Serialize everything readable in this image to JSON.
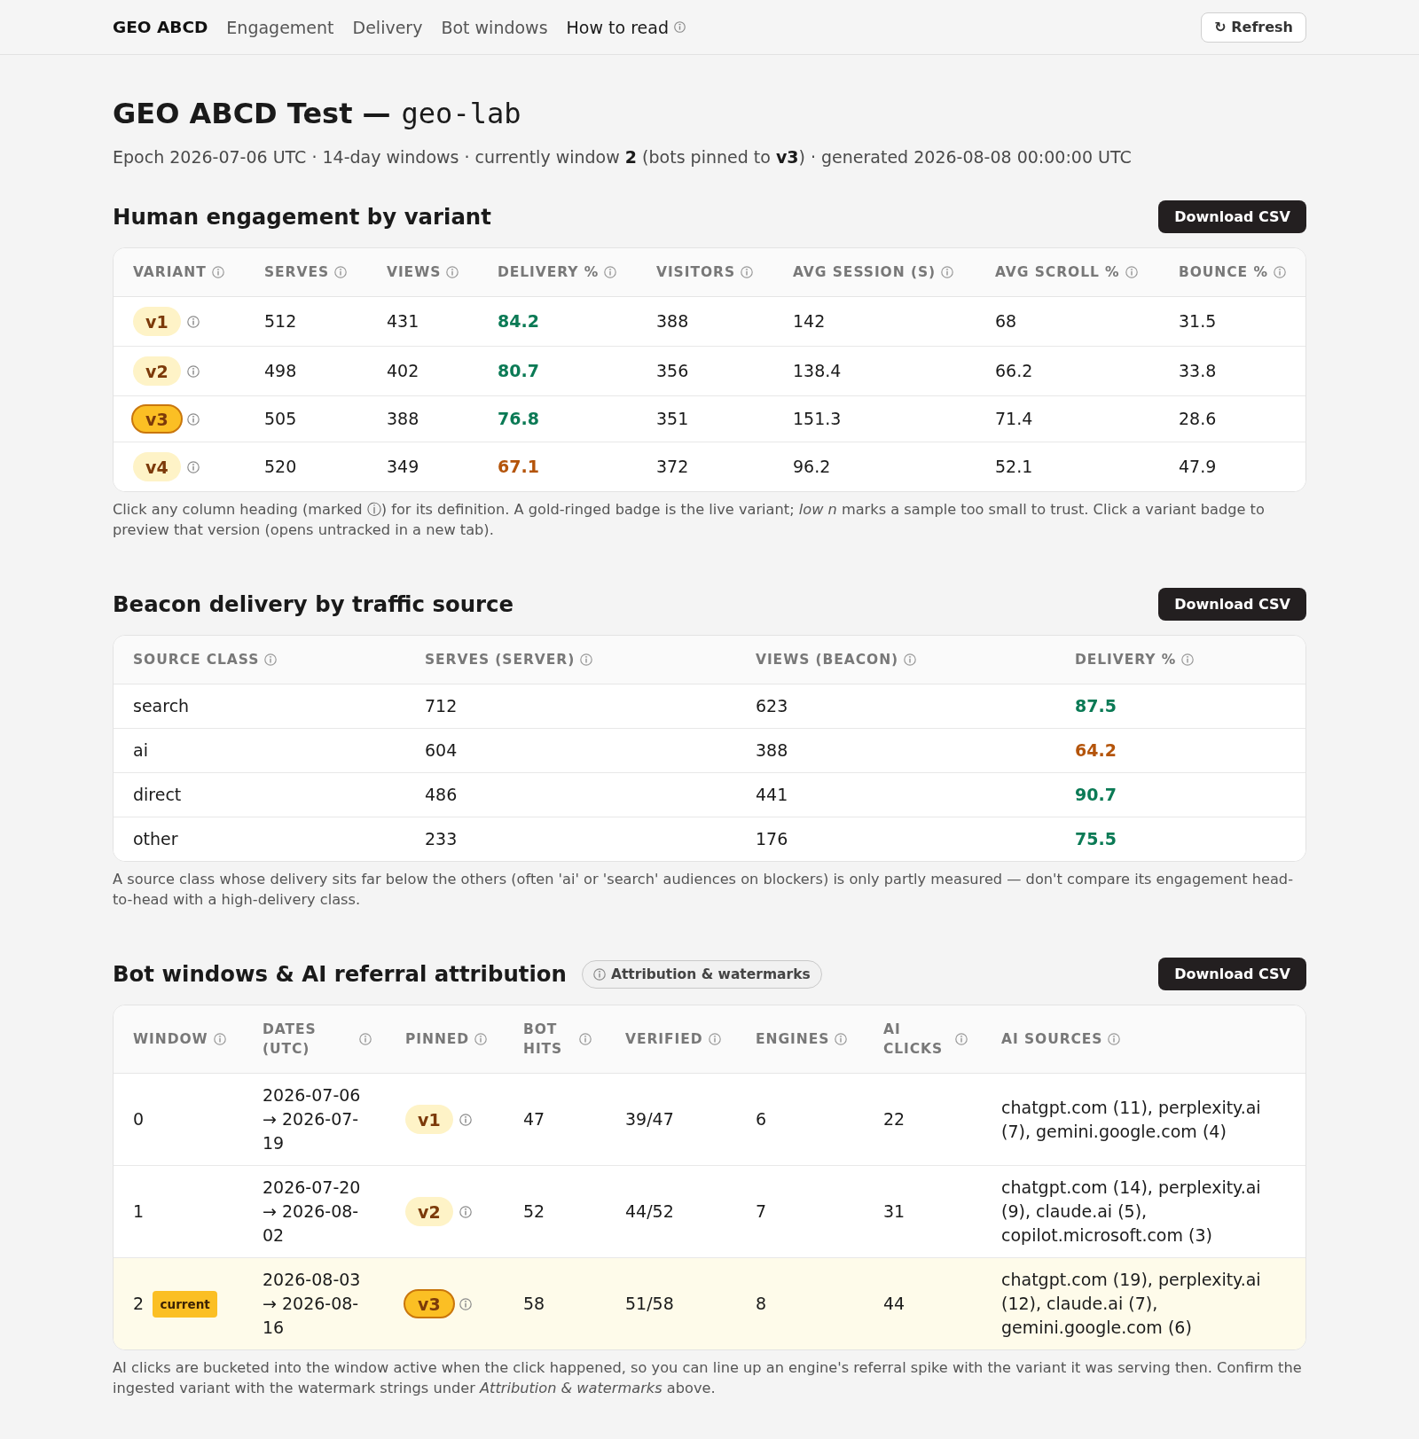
{
  "nav": {
    "brand": "GEO ABCD",
    "links": [
      {
        "label": "Engagement",
        "kind": "link"
      },
      {
        "label": "Delivery",
        "kind": "link"
      },
      {
        "label": "Bot windows",
        "kind": "link"
      },
      {
        "label": "How to read",
        "kind": "help"
      }
    ],
    "refresh": "↻ Refresh"
  },
  "header": {
    "title": "GEO ABCD Test —",
    "slug": "geo-lab",
    "subtitle": "Epoch 2026-07-06 UTC · 14-day windows · currently window **2** (bots pinned to **v3**) · generated 2026-08-08 00:00:00 UTC"
  },
  "sections": [
    {
      "title": "Human engagement by variant",
      "download": "Download CSV",
      "columns": [
        "VARIANT",
        "SERVES",
        "VIEWS",
        "DELIVERY %",
        "VISITORS",
        "AVG SESSION (S)",
        "AVG SCROLL %",
        "BOUNCE %"
      ],
      "rows": [
        {
          "cells": [
            {
              "kind": "variant",
              "text": "v1",
              "live": false
            },
            {
              "kind": "text",
              "text": "512"
            },
            {
              "kind": "text",
              "text": "431"
            },
            {
              "kind": "delivery",
              "text": "84.2",
              "low": false
            },
            {
              "kind": "text",
              "text": "388"
            },
            {
              "kind": "text",
              "text": "142"
            },
            {
              "kind": "text",
              "text": "68"
            },
            {
              "kind": "text",
              "text": "31.5"
            }
          ]
        },
        {
          "cells": [
            {
              "kind": "variant",
              "text": "v2",
              "live": false
            },
            {
              "kind": "text",
              "text": "498"
            },
            {
              "kind": "text",
              "text": "402"
            },
            {
              "kind": "delivery",
              "text": "80.7",
              "low": false
            },
            {
              "kind": "text",
              "text": "356"
            },
            {
              "kind": "text",
              "text": "138.4"
            },
            {
              "kind": "text",
              "text": "66.2"
            },
            {
              "kind": "text",
              "text": "33.8"
            }
          ]
        },
        {
          "cells": [
            {
              "kind": "variant",
              "text": "v3",
              "live": true
            },
            {
              "kind": "text",
              "text": "505"
            },
            {
              "kind": "text",
              "text": "388"
            },
            {
              "kind": "delivery",
              "text": "76.8",
              "low": false
            },
            {
              "kind": "text",
              "text": "351"
            },
            {
              "kind": "text",
              "text": "151.3"
            },
            {
              "kind": "text",
              "text": "71.4"
            },
            {
              "kind": "text",
              "text": "28.6"
            }
          ]
        },
        {
          "cells": [
            {
              "kind": "variant",
              "text": "v4",
              "live": false
            },
            {
              "kind": "text",
              "text": "520"
            },
            {
              "kind": "text",
              "text": "349"
            },
            {
              "kind": "delivery",
              "text": "67.1",
              "low": true
            },
            {
              "kind": "text",
              "text": "372"
            },
            {
              "kind": "text",
              "text": "96.2"
            },
            {
              "kind": "text",
              "text": "52.1"
            },
            {
              "kind": "text",
              "text": "47.9"
            }
          ]
        }
      ],
      "note": "Click any column heading (marked ⓘ) for its definition. A gold-ringed badge is the live variant; *low n* marks a sample too small to trust. Click a variant badge to preview that version (opens untracked in a new tab)."
    },
    {
      "title": "Beacon delivery by traffic source",
      "download": "Download CSV",
      "columns": [
        "SOURCE CLASS",
        "SERVES (SERVER)",
        "VIEWS (BEACON)",
        "DELIVERY %"
      ],
      "rows": [
        {
          "cells": [
            {
              "kind": "text",
              "text": "search"
            },
            {
              "kind": "text",
              "text": "712"
            },
            {
              "kind": "text",
              "text": "623"
            },
            {
              "kind": "delivery",
              "text": "87.5",
              "low": false
            }
          ]
        },
        {
          "cells": [
            {
              "kind": "text",
              "text": "ai"
            },
            {
              "kind": "text",
              "text": "604"
            },
            {
              "kind": "text",
              "text": "388"
            },
            {
              "kind": "delivery",
              "text": "64.2",
              "low": true
            }
          ]
        },
        {
          "cells": [
            {
              "kind": "text",
              "text": "direct"
            },
            {
              "kind": "text",
              "text": "486"
            },
            {
              "kind": "text",
              "text": "441"
            },
            {
              "kind": "delivery",
              "text": "90.7",
              "low": false
            }
          ]
        },
        {
          "cells": [
            {
              "kind": "text",
              "text": "other"
            },
            {
              "kind": "text",
              "text": "233"
            },
            {
              "kind": "text",
              "text": "176"
            },
            {
              "kind": "delivery",
              "text": "75.5",
              "low": false
            }
          ]
        }
      ],
      "note": "A source class whose delivery sits far below the others (often 'ai' or 'search' audiences on blockers) is only partly measured — don't compare its engagement head-to-head with a high-delivery class."
    },
    {
      "title": "Bot windows & AI referral attribution",
      "help": "Attribution & watermarks",
      "download": "Download CSV",
      "columns": [
        "WINDOW",
        "DATES (UTC)",
        "PINNED",
        "BOT HITS",
        "VERIFIED",
        "ENGINES",
        "AI CLICKS",
        "AI SOURCES"
      ],
      "rows": [
        {
          "current": false,
          "cells": [
            {
              "kind": "text",
              "text": "0"
            },
            {
              "kind": "text",
              "text": "2026-07-06 → 2026-07-19"
            },
            {
              "kind": "variant",
              "text": "v1",
              "live": false
            },
            {
              "kind": "text",
              "text": "47"
            },
            {
              "kind": "text",
              "text": "39/47"
            },
            {
              "kind": "text",
              "text": "6"
            },
            {
              "kind": "text",
              "text": "22"
            },
            {
              "kind": "text",
              "text": "chatgpt.com (11), perplexity.ai (7), gemini.google.com (4)"
            }
          ]
        },
        {
          "current": false,
          "cells": [
            {
              "kind": "text",
              "text": "1"
            },
            {
              "kind": "text",
              "text": "2026-07-20 → 2026-08-02"
            },
            {
              "kind": "variant",
              "text": "v2",
              "live": false
            },
            {
              "kind": "text",
              "text": "52"
            },
            {
              "kind": "text",
              "text": "44/52"
            },
            {
              "kind": "text",
              "text": "7"
            },
            {
              "kind": "text",
              "text": "31"
            },
            {
              "kind": "text",
              "text": "chatgpt.com (14), perplexity.ai (9), claude.ai (5), copilot.microsoft.com (3)"
            }
          ]
        },
        {
          "current": true,
          "cells": [
            {
              "kind": "text",
              "text": "2",
              "tag": "current"
            },
            {
              "kind": "text",
              "text": "2026-08-03 → 2026-08-16"
            },
            {
              "kind": "variant",
              "text": "v3",
              "live": true
            },
            {
              "kind": "text",
              "text": "58"
            },
            {
              "kind": "text",
              "text": "51/58"
            },
            {
              "kind": "text",
              "text": "8"
            },
            {
              "kind": "text",
              "text": "44"
            },
            {
              "kind": "text",
              "text": "chatgpt.com (19), perplexity.ai (12), claude.ai (7), gemini.google.com (6)"
            }
          ]
        }
      ],
      "note": "AI clicks are bucketed into the window active when the click happened, so you can line up an engine's referral spike with the variant it was serving then. Confirm the ingested variant with the watermark strings under *Attribution & watermarks* above."
    }
  ]
}
